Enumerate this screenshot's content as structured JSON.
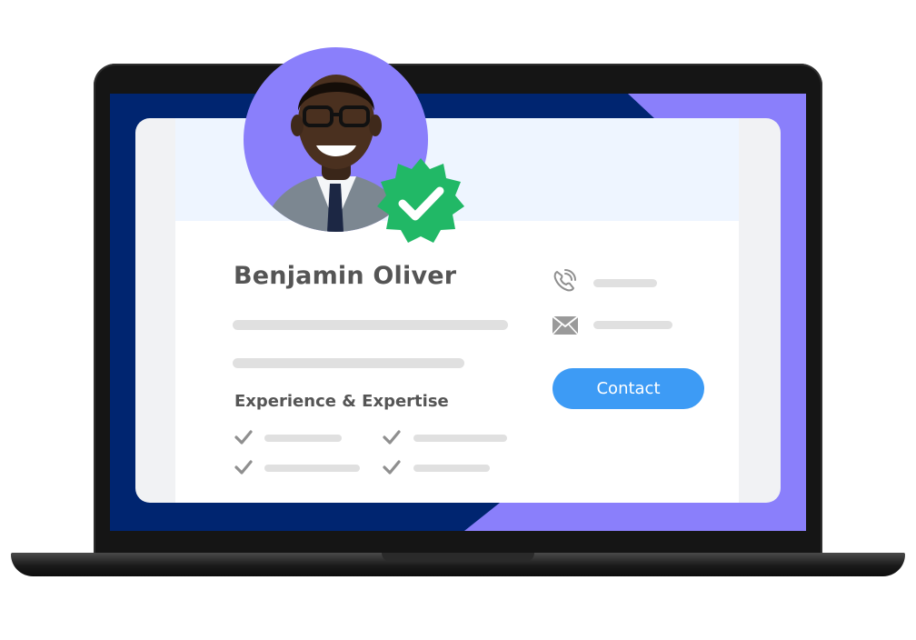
{
  "profile": {
    "name": "Benjamin Oliver",
    "section_title": "Experience & Expertise",
    "verified_icon": "verified-badge-icon"
  },
  "contact": {
    "button_label": "Contact",
    "icons": [
      "phone-icon",
      "mail-icon"
    ]
  },
  "colors": {
    "screen_navy": "#002570",
    "screen_purple": "#8a7ffb",
    "button_blue": "#3d9bf5",
    "badge_green": "#21b866",
    "text_gray": "#555555",
    "placeholder_gray": "#e0e0e0"
  }
}
